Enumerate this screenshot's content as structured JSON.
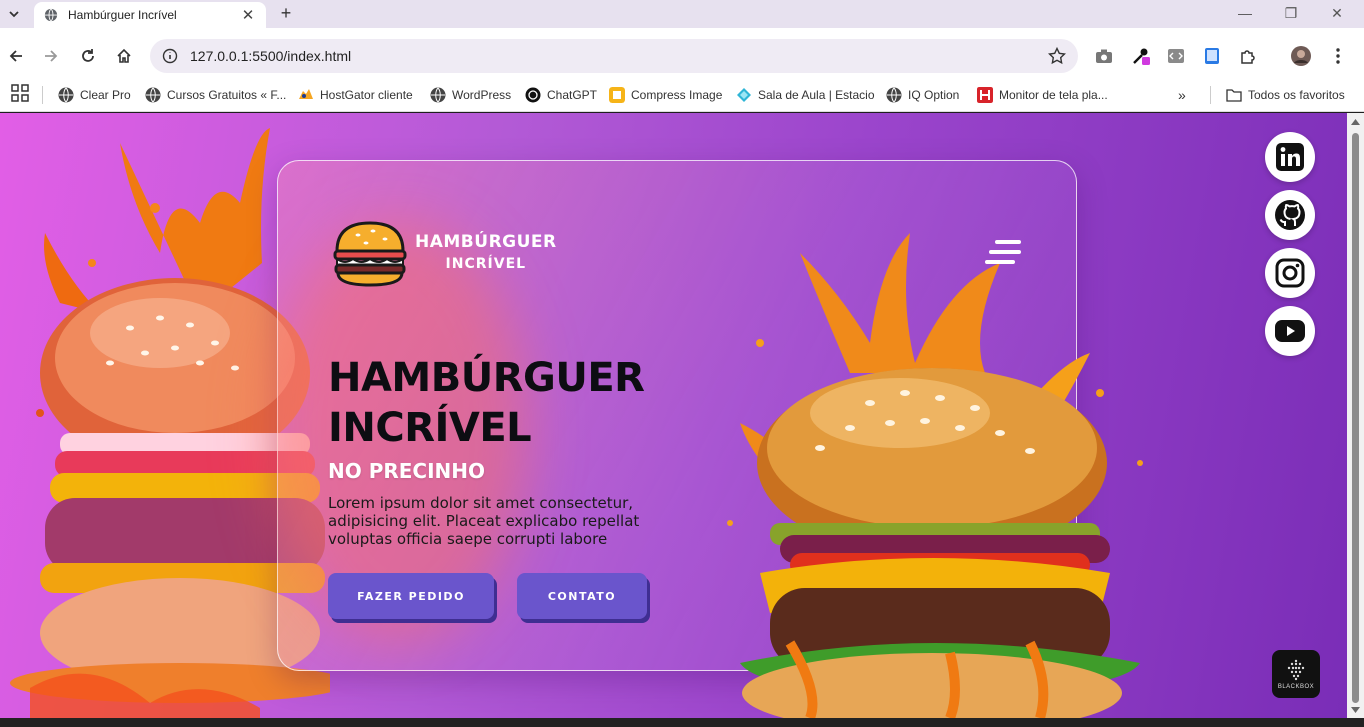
{
  "browser": {
    "tab_title": "Hambúrguer Incrível",
    "url": "127.0.0.1:5500/index.html",
    "bookmarks": [
      {
        "label": "Clear Pro",
        "icon": "globe-icon"
      },
      {
        "label": "Cursos Gratuitos « F...",
        "icon": "globe-icon"
      },
      {
        "label": "HostGator cliente",
        "icon": "hostgator-icon"
      },
      {
        "label": "WordPress",
        "icon": "globe-icon"
      },
      {
        "label": "ChatGPT",
        "icon": "chatgpt-icon"
      },
      {
        "label": "Compress Image",
        "icon": "compress-image-icon"
      },
      {
        "label": "Sala de Aula | Estacio",
        "icon": "estacio-icon"
      },
      {
        "label": "IQ Option",
        "icon": "globe-icon"
      },
      {
        "label": "Monitor de tela pla...",
        "icon": "monitor-icon"
      }
    ],
    "all_bookmarks": "Todos os favoritos"
  },
  "page": {
    "logo": {
      "line1": "HAMBÚRGUER",
      "line2": "INCRÍVEL"
    },
    "hero": {
      "title_line1": "HAMBÚRGUER",
      "title_line2": "INCRÍVEL",
      "subtitle": "NO PRECINHO",
      "text": "Lorem ipsum dolor sit amet consectetur, adipisicing elit. Placeat explicabo repellat voluptas officia saepe corrupti labore"
    },
    "buttons": {
      "order": "FAZER PEDIDO",
      "contact": "CONTATO"
    },
    "social": [
      "linkedin-icon",
      "github-icon",
      "instagram-icon",
      "youtube-icon"
    ],
    "widget_label": "BLACKBOX"
  },
  "colors": {
    "background_start": "#e25ee6",
    "background_end": "#7a2db7",
    "button": "#6a55cc",
    "button_shadow": "#3f2e92",
    "title": "#0d0d12"
  }
}
